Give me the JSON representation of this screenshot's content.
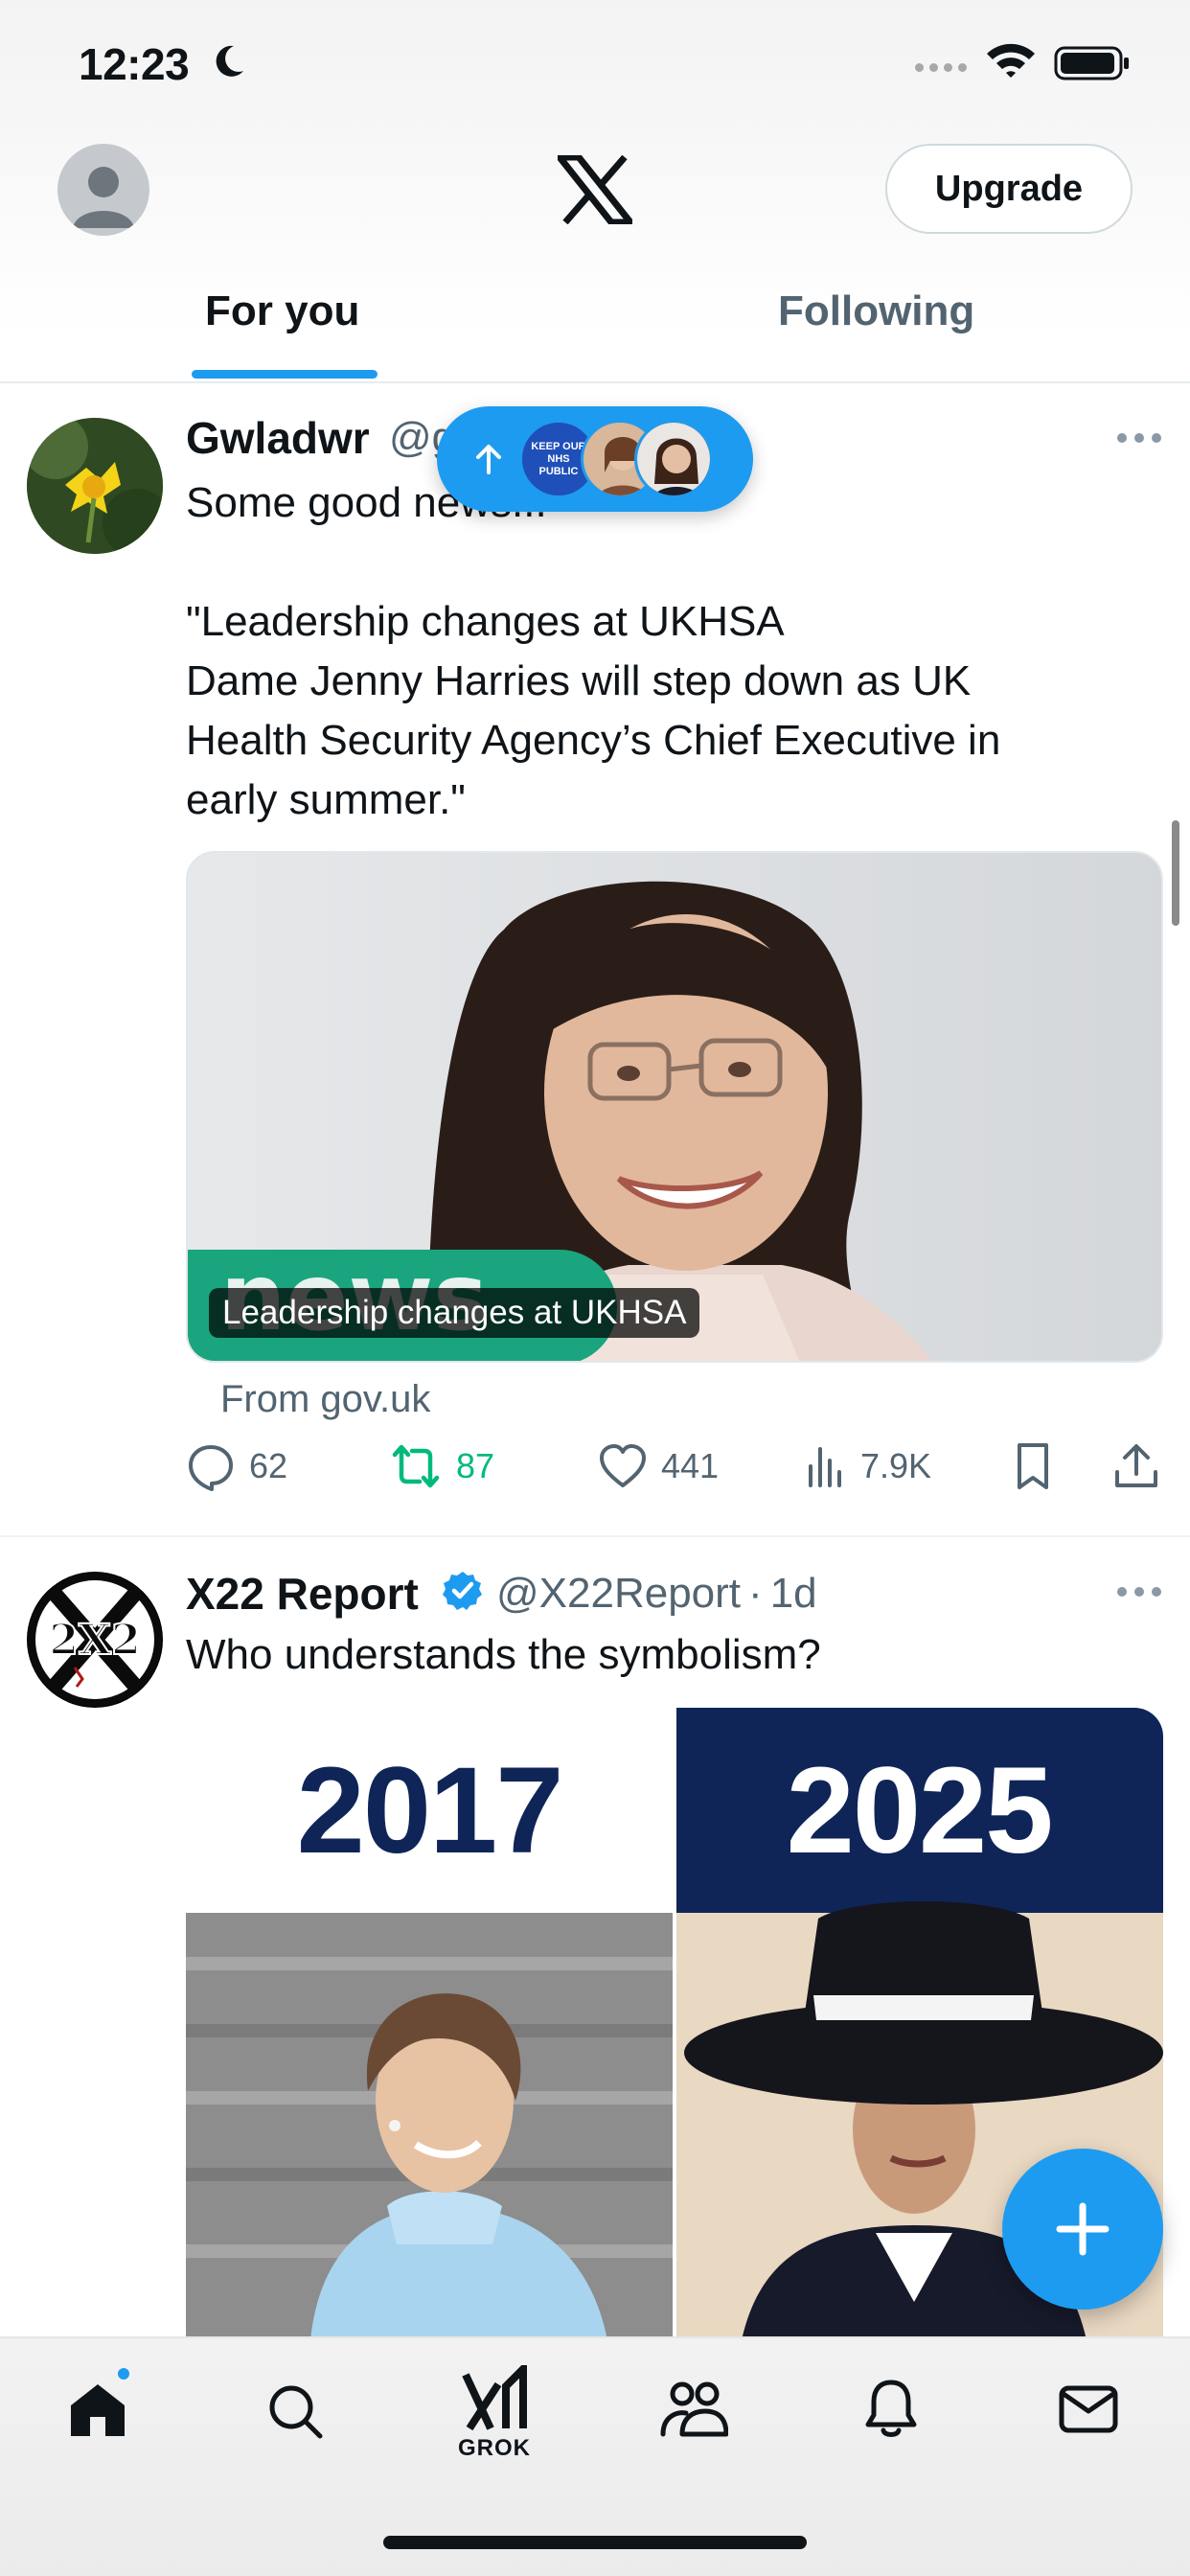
{
  "status_bar": {
    "time": "12:23"
  },
  "header": {
    "upgrade_label": "Upgrade"
  },
  "tabs": [
    {
      "label": "For you",
      "active": true
    },
    {
      "label": "Following",
      "active": false
    }
  ],
  "new_posts_pill": {
    "avatar_text": "KEEP OUR NHS PUBLIC"
  },
  "posts": [
    {
      "display_name": "Gwladwr",
      "handle": "@g",
      "text": "Some good news...\n\n\"Leadership changes at UKHSA\nDame Jenny Harries will step down as UK\nHealth Security Agency’s Chief Executive in\nearly summer.\"",
      "card": {
        "title": "Leadership changes at UKHSA",
        "badge_text": "news",
        "source": "From gov.uk"
      },
      "actions": {
        "replies": "62",
        "reposts": "87",
        "likes": "441",
        "views": "7.9K"
      }
    },
    {
      "display_name": "X22 Report",
      "handle": "@X22Report",
      "time": "1d",
      "separator": "·",
      "avatar_text": "2X2",
      "text": "Who understands the symbolism?",
      "media": {
        "left_label": "2017",
        "right_label": "2025"
      }
    }
  ],
  "tabbar": {
    "grok_label": "GROK"
  },
  "colors": {
    "accent": "#1d9bf0",
    "repost_active": "#00ba7c",
    "text_secondary": "#536471"
  }
}
